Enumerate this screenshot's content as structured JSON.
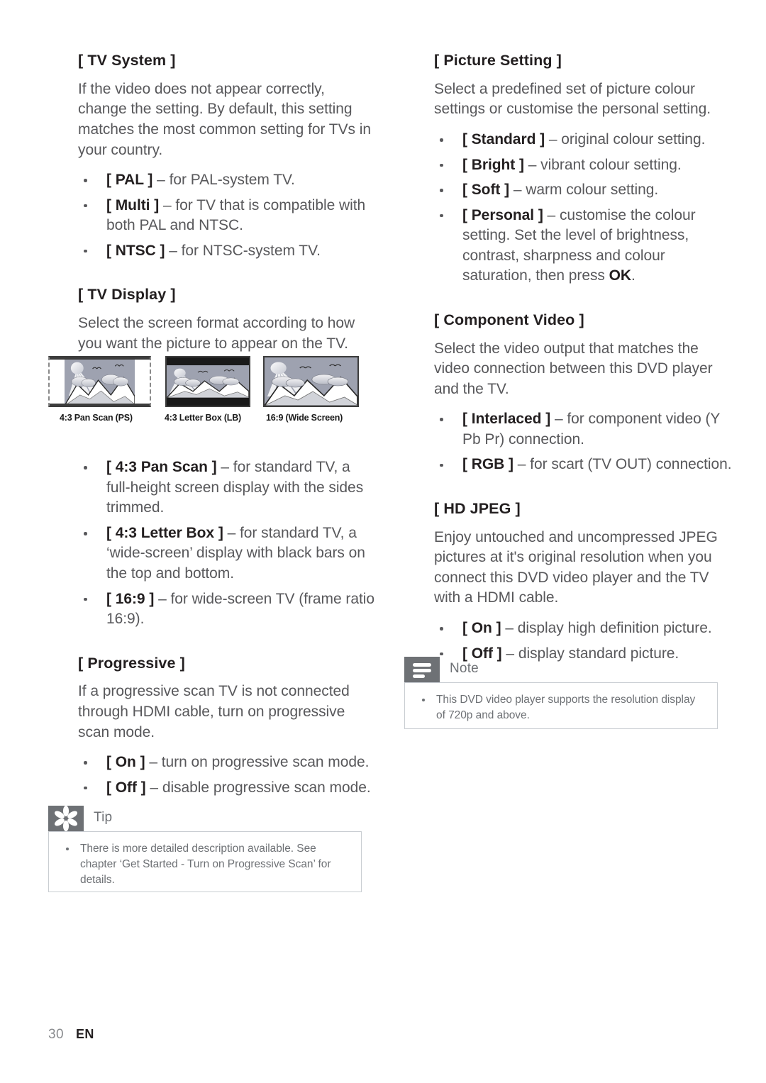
{
  "document": {
    "page_number": "30",
    "language_code": "EN"
  },
  "left_column": {
    "tv_system": {
      "heading": "[ TV System ]",
      "paragraph": "If the video does not appear correctly, change the setting. By default, this setting matches the most common setting for TVs in your country.",
      "options": [
        {
          "term": "[ PAL ]",
          "desc": "– for PAL-system TV."
        },
        {
          "term": "[ Multi ]",
          "desc": "– for TV that is compatible with both PAL and NTSC."
        },
        {
          "term": "[ NTSC ]",
          "desc": "– for NTSC-system TV."
        }
      ]
    },
    "tv_display": {
      "heading": "[ TV Display ]",
      "paragraph": "Select the screen format according to how you want the picture to appear on the TV.",
      "figure": {
        "captions": [
          "4:3 Pan Scan (PS)",
          "4:3 Letter Box (LB)",
          "16:9 (Wide Screen)"
        ]
      },
      "options": [
        {
          "term": "[ 4:3 Pan Scan ]",
          "desc": "– for standard TV, a full-height screen display with the sides trimmed."
        },
        {
          "term": "[ 4:3 Letter Box ]",
          "desc": "– for standard TV,  a ‘wide-screen’ display with black bars on the top and bottom."
        },
        {
          "term": "[ 16:9 ]",
          "desc": "– for wide-screen TV (frame ratio 16:9)."
        }
      ]
    },
    "progressive": {
      "heading": "[ Progressive ]",
      "paragraph": "If a progressive scan TV is not connected through HDMI cable, turn on progressive scan mode.",
      "options": [
        {
          "term": "[ On ]",
          "desc": "– turn on progressive scan mode."
        },
        {
          "term": "[ Off ]",
          "desc": "– disable progressive scan mode."
        }
      ]
    },
    "tip_box": {
      "icon": "asterisk-icon",
      "title": "Tip",
      "items": [
        "There is more detailed description available. See chapter ‘Get Started - Turn on Progressive Scan’ for details."
      ]
    }
  },
  "right_column": {
    "picture_setting": {
      "heading": "[ Picture Setting ]",
      "paragraph": "Select a predefined set of picture colour settings or customise the personal setting.",
      "options": [
        {
          "term": "[ Standard ]",
          "desc": "– original colour setting."
        },
        {
          "term": "[ Bright ]",
          "desc": "– vibrant colour setting."
        },
        {
          "term": "[ Soft ]",
          "desc": "– warm colour setting."
        },
        {
          "term": "[ Personal ]",
          "desc": "– customise the colour setting. Set the level of brightness, contrast, sharpness and colour saturation, then press ",
          "desc_strong": "OK",
          "desc_tail": "."
        }
      ]
    },
    "component_video": {
      "heading": "[ Component Video ]",
      "paragraph": "Select the video output that matches the video connection between this DVD player and the TV.",
      "options": [
        {
          "term": "[ Interlaced ]",
          "desc": "– for component video (Y Pb Pr) connection."
        },
        {
          "term": "[ RGB ]",
          "desc": "– for scart (TV OUT) connection."
        }
      ]
    },
    "hd_jpeg": {
      "heading": "[ HD JPEG ]",
      "paragraph": "Enjoy untouched and uncompressed JPEG pictures at it's original resolution when you connect this DVD video player and the TV with a HDMI cable.",
      "options": [
        {
          "term": "[ On ]",
          "desc": "– display high definition picture."
        },
        {
          "term": "[ Off ]",
          "desc": "– display standard picture."
        }
      ]
    },
    "note_box": {
      "icon": "note-lines-icon",
      "title": "Note",
      "items": [
        "This DVD video player supports the resolution display of 720p and above."
      ]
    }
  },
  "colors": {
    "heading_text": "#231f20",
    "body_text": "#58585b",
    "callout_gray": "#6e7175",
    "callout_border": "#c9cdd2",
    "scene_sky": "#9ea2b0",
    "frame_border": "#3c3c3c"
  }
}
